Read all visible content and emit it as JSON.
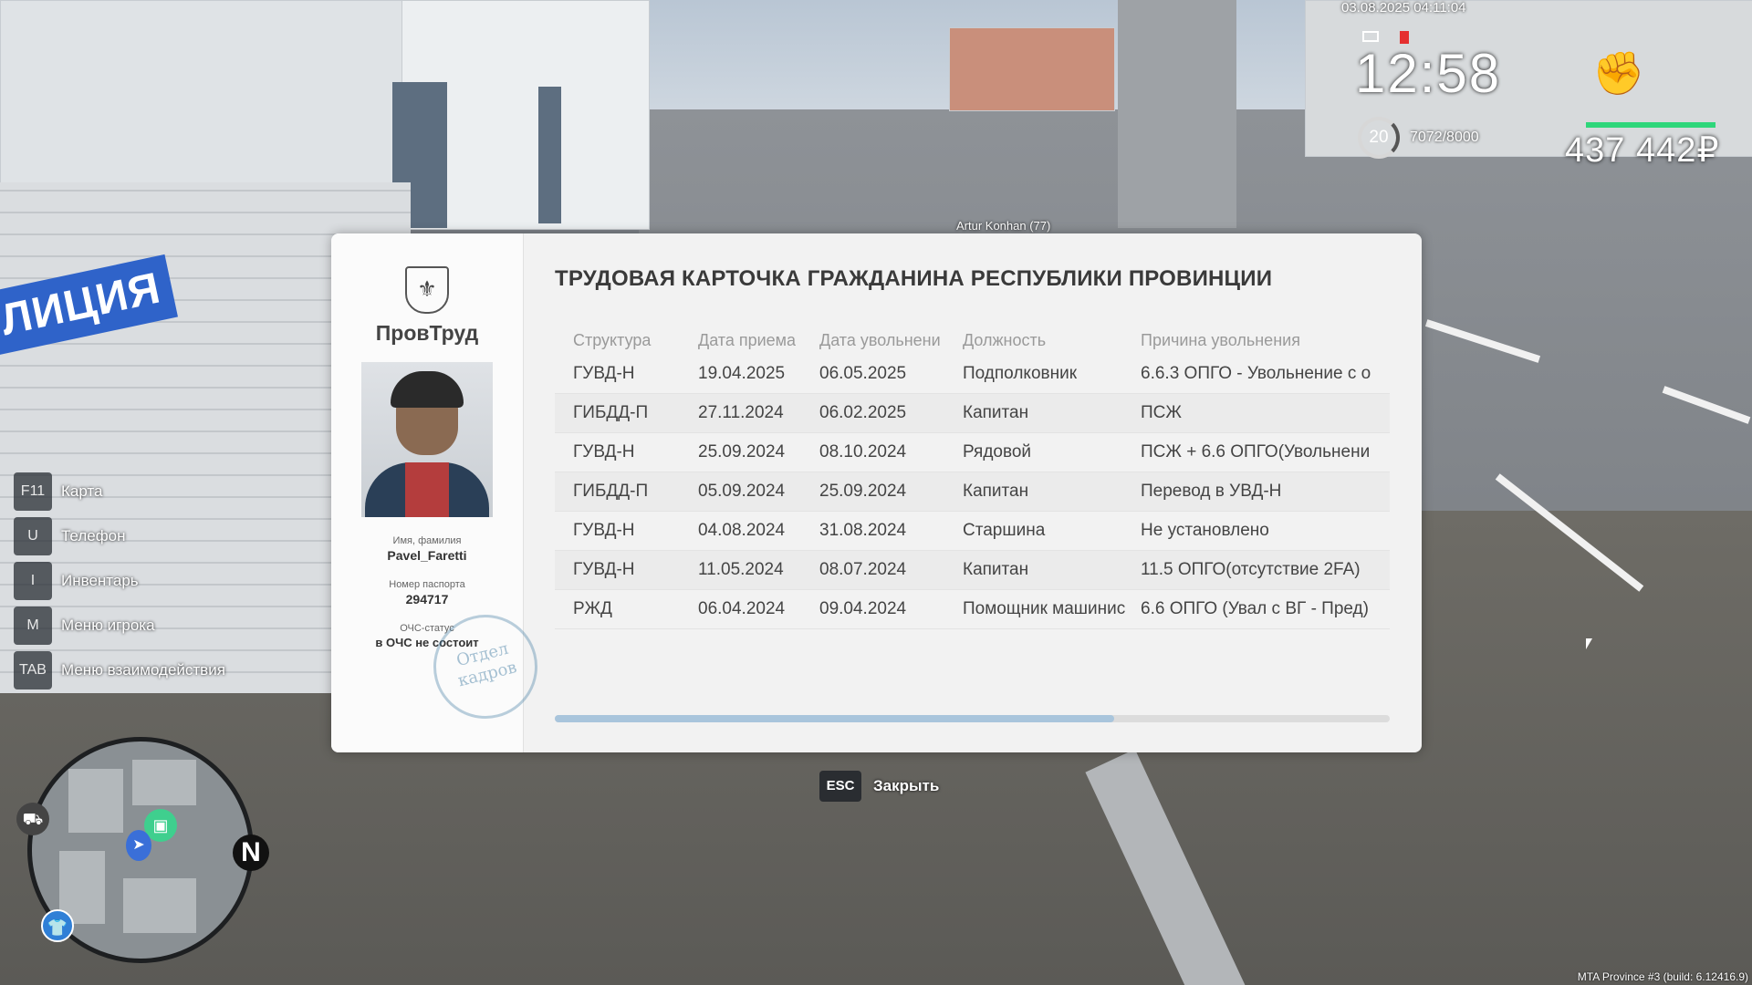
{
  "hud": {
    "datetime": "03.08.2025 04:11:04",
    "clock": "12:58",
    "level": "20",
    "xp": "7072/8000",
    "money": "437 442₽",
    "player_tag": "Artur Konhan (77)",
    "icons": [
      "mail-icon",
      "alert-icon",
      "fist-icon"
    ]
  },
  "hints": [
    {
      "key": "F11",
      "label": "Карта"
    },
    {
      "key": "U",
      "label": "Телефон"
    },
    {
      "key": "I",
      "label": "Инвентарь"
    },
    {
      "key": "M",
      "label": "Меню игрока"
    },
    {
      "key": "TAB",
      "label": "Меню взаимодействия"
    }
  ],
  "minimap": {
    "north": "N"
  },
  "card": {
    "agency": "ПровТруд",
    "title": "ТРУДОВАЯ КАРТОЧКА ГРАЖДАНИНА РЕСПУБЛИКИ ПРОВИНЦИИ",
    "name_caption": "Имя, фамилия",
    "name": "Pavel_Faretti",
    "passport_caption": "Номер паспорта",
    "passport": "294717",
    "ochs_caption": "ОЧС-статус",
    "ochs": "в ОЧС не состоит",
    "stamp": "Отдел кадров",
    "columns": [
      "Структура",
      "Дата приема",
      "Дата увольнени",
      "Должность",
      "Причина увольнения"
    ],
    "rows": [
      [
        "ГУВД-Н",
        "19.04.2025",
        "06.05.2025",
        "Подполковник",
        "6.6.3 ОПГО - Увольнение с о"
      ],
      [
        "ГИБДД-П",
        "27.11.2024",
        "06.02.2025",
        "Капитан",
        "ПСЖ"
      ],
      [
        "ГУВД-Н",
        "25.09.2024",
        "08.10.2024",
        "Рядовой",
        "ПСЖ + 6.6 ОПГО(Увольнени"
      ],
      [
        "ГИБДД-П",
        "05.09.2024",
        "25.09.2024",
        "Капитан",
        "Перевод в УВД-Н"
      ],
      [
        "ГУВД-Н",
        "04.08.2024",
        "31.08.2024",
        "Старшина",
        "Не установлено"
      ],
      [
        "ГУВД-Н",
        "11.05.2024",
        "08.07.2024",
        "Капитан",
        "11.5 ОПГО(отсутствие 2FA)"
      ],
      [
        "РЖД",
        "06.04.2024",
        "09.04.2024",
        "Помощник машинис",
        "6.6 ОПГО (Увал с ВГ - Пред)"
      ]
    ],
    "scroll_fraction": 0.67
  },
  "close": {
    "key": "ESC",
    "label": "Закрыть"
  },
  "build": "MTA Province #3 (build: 6.12416.9)",
  "wall_sign": "ЛИЦИЯ",
  "colors": {
    "accent": "#a9c5dc",
    "health": "#2ed67a"
  }
}
